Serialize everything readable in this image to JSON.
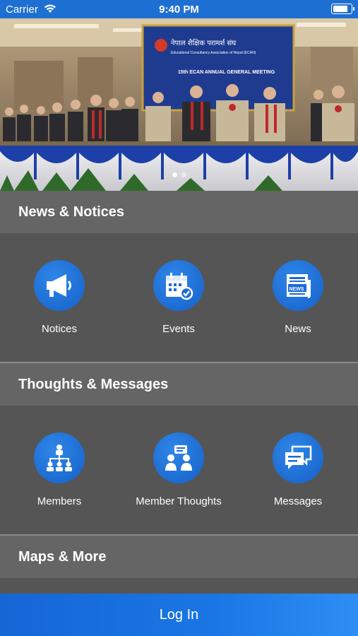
{
  "status_bar": {
    "carrier": "Carrier",
    "time": "9:40 PM",
    "wifi_icon": "wifi-icon",
    "battery_icon": "battery-icon"
  },
  "hero": {
    "banner_title_np": "नेपाल शैक्षिक परामर्श संघ",
    "banner_subtitle": "Educational Consultancy Association of Nepal (ECAN)",
    "banner_meeting": "15th ECAN ANNUAL GENERAL MEETING",
    "slides_total": 2,
    "slide_active": 1
  },
  "sections": {
    "news": {
      "title": "News & Notices",
      "items": [
        {
          "label": "Notices",
          "icon": "megaphone-icon"
        },
        {
          "label": "Events",
          "icon": "calendar-icon"
        },
        {
          "label": "News",
          "icon": "newspaper-icon"
        }
      ]
    },
    "thoughts": {
      "title": "Thoughts & Messages",
      "items": [
        {
          "label": "Members",
          "icon": "org-chart-icon"
        },
        {
          "label": "Member Thoughts",
          "icon": "discussion-icon"
        },
        {
          "label": "Messages",
          "icon": "chat-bubbles-icon"
        }
      ]
    },
    "maps": {
      "title": "Maps & More"
    }
  },
  "login": {
    "label": "Log In"
  },
  "colors": {
    "status_bar": "#1e6fd2",
    "accent": "#1a76e4",
    "header_bg": "#656565",
    "body_bg": "#555555"
  }
}
